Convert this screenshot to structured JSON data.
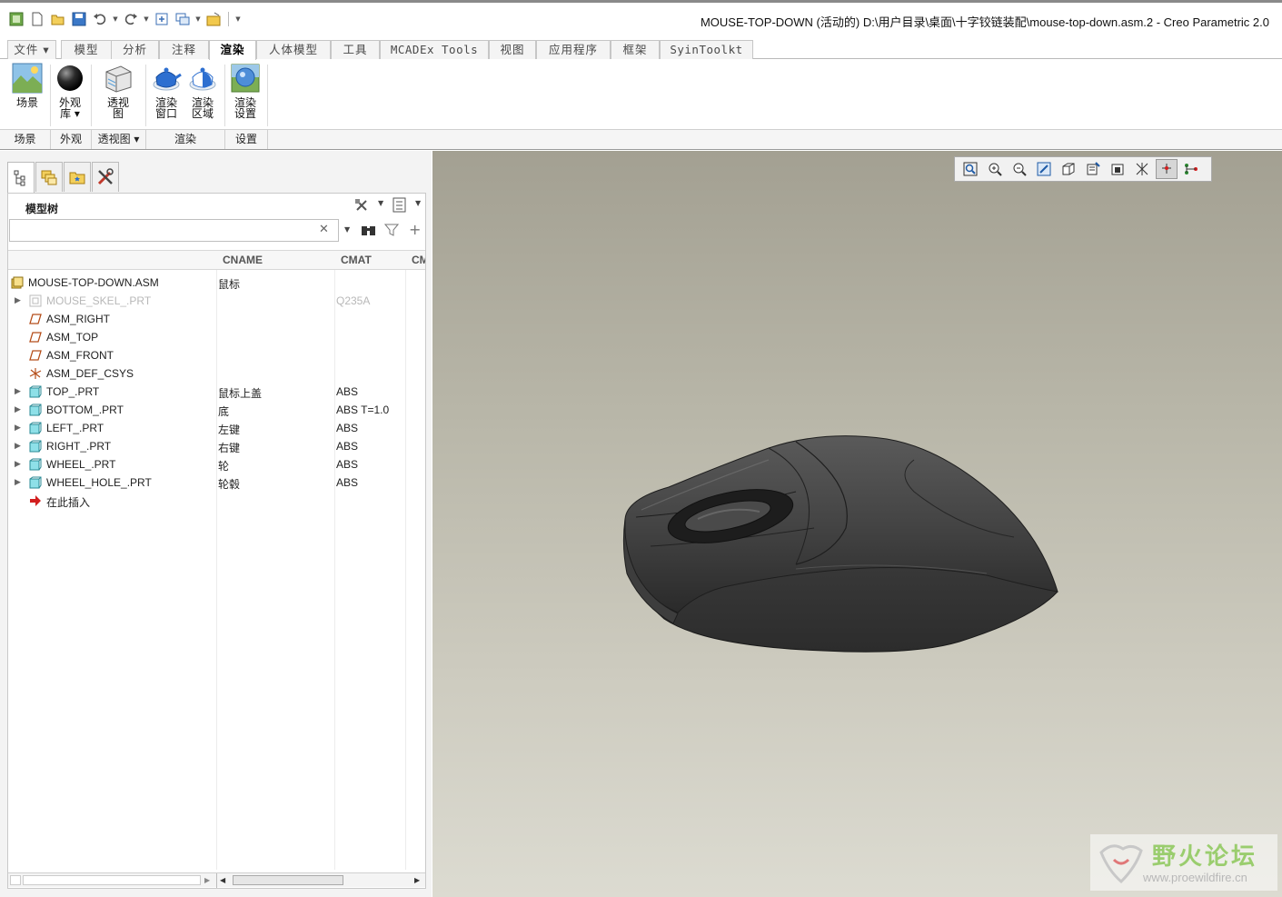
{
  "window": {
    "title": "MOUSE-TOP-DOWN (活动的) D:\\用户目录\\桌面\\十字铰链装配\\mouse-top-down.asm.2 - Creo Parametric 2.0"
  },
  "quick_access": {
    "icons": [
      "app-icon",
      "new-icon",
      "open-icon",
      "save-icon",
      "undo-icon",
      "redo-icon",
      "regenerate-icon",
      "windows-icon",
      "close-icon",
      "customize-icon"
    ]
  },
  "ribbon": {
    "tabs": [
      {
        "label": "文件 ▾"
      },
      {
        "label": "模型"
      },
      {
        "label": "分析"
      },
      {
        "label": "注释"
      },
      {
        "label": "渲染"
      },
      {
        "label": "人体模型"
      },
      {
        "label": "工具"
      },
      {
        "label": "MCADEx Tools"
      },
      {
        "label": "视图"
      },
      {
        "label": "应用程序"
      },
      {
        "label": "框架"
      },
      {
        "label": "SyinToolkt"
      }
    ],
    "active_tab": "渲染",
    "tools": [
      {
        "label": "场景",
        "icon": "scene-icon"
      },
      {
        "label": "外观库 ▾",
        "icon": "appearance-gallery-icon"
      },
      {
        "label": "透视图",
        "icon": "perspective-icon"
      },
      {
        "label": "渲染窗口",
        "icon": "render-window-icon"
      },
      {
        "label": "渲染区域",
        "icon": "render-region-icon"
      },
      {
        "label": "渲染设置",
        "icon": "render-setup-icon"
      }
    ],
    "groups": [
      {
        "label": "场景"
      },
      {
        "label": "外观"
      },
      {
        "label": "透视图 ▾"
      },
      {
        "label": "渲染"
      },
      {
        "label": "设置"
      }
    ]
  },
  "model_tree": {
    "title": "模型树",
    "search": {
      "value": "",
      "placeholder": "",
      "clear": "✕"
    },
    "columns": [
      "CNAME",
      "CMAT",
      "CM"
    ],
    "root": {
      "name": "MOUSE-TOP-DOWN.ASM",
      "cname": "鼠标",
      "cmat": ""
    },
    "items": [
      {
        "name": "MOUSE_SKEL_.PRT",
        "cname": "",
        "cmat": "Q235A",
        "icon": "skeleton-part-icon",
        "expandable": true,
        "dim": true
      },
      {
        "name": "ASM_RIGHT",
        "cname": "",
        "cmat": "",
        "icon": "datum-plane-icon",
        "expandable": false,
        "dim": false
      },
      {
        "name": "ASM_TOP",
        "cname": "",
        "cmat": "",
        "icon": "datum-plane-icon",
        "expandable": false,
        "dim": false
      },
      {
        "name": "ASM_FRONT",
        "cname": "",
        "cmat": "",
        "icon": "datum-plane-icon",
        "expandable": false,
        "dim": false
      },
      {
        "name": "ASM_DEF_CSYS",
        "cname": "",
        "cmat": "",
        "icon": "csys-icon",
        "expandable": false,
        "dim": false
      },
      {
        "name": "TOP_.PRT",
        "cname": "鼠标上盖",
        "cmat": "ABS",
        "icon": "part-icon",
        "expandable": true,
        "dim": false
      },
      {
        "name": "BOTTOM_.PRT",
        "cname": "底",
        "cmat": "ABS T=1.0",
        "icon": "part-icon",
        "expandable": true,
        "dim": false
      },
      {
        "name": "LEFT_.PRT",
        "cname": "左键",
        "cmat": "ABS",
        "icon": "part-icon",
        "expandable": true,
        "dim": false
      },
      {
        "name": "RIGHT_.PRT",
        "cname": "右键",
        "cmat": "ABS",
        "icon": "part-icon",
        "expandable": true,
        "dim": false
      },
      {
        "name": "WHEEL_.PRT",
        "cname": "轮",
        "cmat": "ABS",
        "icon": "part-icon",
        "expandable": true,
        "dim": false
      },
      {
        "name": "WHEEL_HOLE_.PRT",
        "cname": "轮毂",
        "cmat": "ABS",
        "icon": "part-icon",
        "expandable": true,
        "dim": false
      },
      {
        "name": "在此插入",
        "cname": "",
        "cmat": "",
        "icon": "insert-here-icon",
        "expandable": false,
        "dim": false
      }
    ]
  },
  "viewport": {
    "toolbar_icons": [
      "refit-icon",
      "zoom-in-icon",
      "zoom-out-icon",
      "repaint-icon",
      "saved-orientations-icon",
      "view-manager-icon",
      "display-style-icon",
      "datum-display-icon",
      "spin-center-icon",
      "annotation-display-icon"
    ],
    "watermark": {
      "title": "野火论坛",
      "url": "www.proewildfire.cn"
    }
  }
}
